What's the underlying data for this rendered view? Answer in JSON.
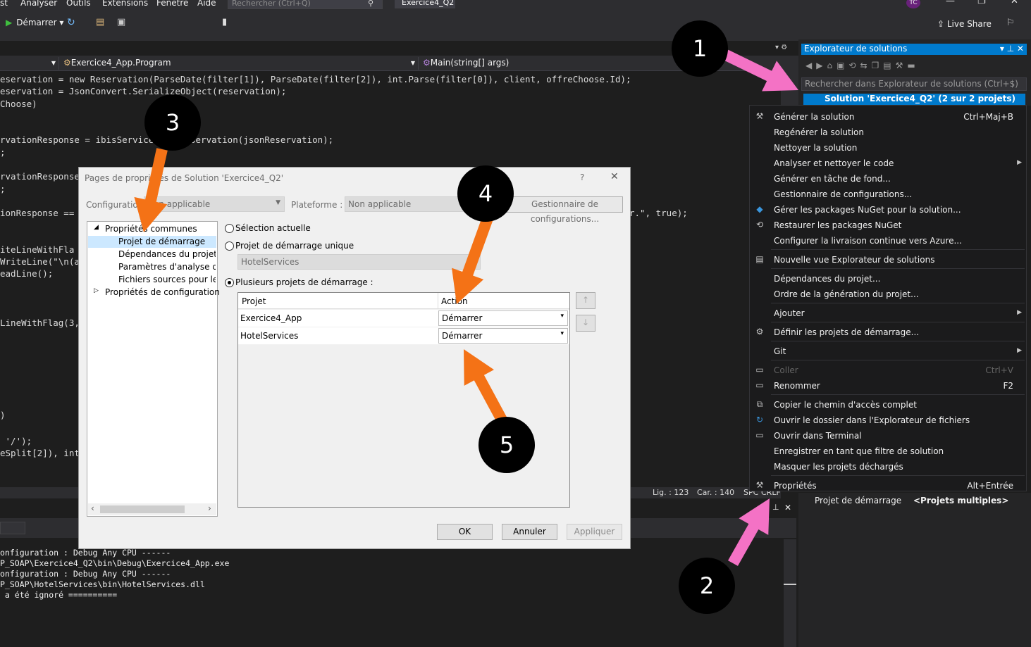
{
  "menubar": {
    "items": [
      "st",
      "Analyser",
      "Outils",
      "Extensions",
      "Fenêtre",
      "Aide"
    ],
    "search_placeholder": "Rechercher (Ctrl+Q)",
    "window_title": "Exercice4_Q2",
    "user_initials": "TC"
  },
  "toolbar": {
    "start_label": "Démarrer",
    "live_share": "Live Share"
  },
  "nav": {
    "class_combo": "Exercice4_App.Program",
    "method_combo": "Main(string[] args)"
  },
  "code_lines": [
    "eservation = new Reservation(ParseDate(filter[1]), ParseDate(filter[2]), int.Parse(filter[0]), client, offreChoose.Id);",
    "eservation = JsonConvert.SerializeObject(reservation);",
    "Choose)",
    "",
    "",
    "rvationResponse = ibisServices",
    ";",
    "",
    "rvationResponse",
    ";",
    "",
    "ionResponse ==",
    "",
    "",
    "iteLineWithFla",
    "WriteLine(\"\\n(ap",
    "eadLine();",
    "",
    "",
    "",
    "LineWithFlag(3,"
  ],
  "code_fragments": {
    "reservation_call": "servation(jsonReservation);",
    "tail_fragment": "r.\", true);",
    "paren": ")",
    "slash": " '/');",
    "split": "eSplit[2]), int"
  },
  "statusbar": {
    "line": "Lig. : 123",
    "col": "Car. : 140",
    "spc": "SPC",
    "crlf": "CRLF"
  },
  "output_lines": [
    "onfiguration : Debug Any CPU ------",
    "P_SOAP\\Exercice4_Q2\\bin\\Debug\\Exercice4_App.exe",
    "onfiguration : Debug Any CPU ------",
    "P_SOAP\\HotelServices\\bin\\HotelServices.dll",
    " a été ignoré =========="
  ],
  "solution_explorer": {
    "title": "Explorateur de solutions",
    "search_placeholder": "Rechercher dans Explorateur de solutions (Ctrl+$)",
    "solution_row": "Solution 'Exercice4_Q2' (2 sur 2 projets)"
  },
  "properties_pane": {
    "key": "Projet de démarrage",
    "value": "<Projets multiples>"
  },
  "context_menu": {
    "items": [
      {
        "label": "Générer la solution",
        "shortcut": "Ctrl+Maj+B",
        "icon": "build-icon",
        "disabled": false,
        "submenu": false
      },
      {
        "label": "Regénérer la solution",
        "shortcut": "",
        "icon": "",
        "disabled": false,
        "submenu": false
      },
      {
        "label": "Nettoyer la solution",
        "shortcut": "",
        "icon": "",
        "disabled": false,
        "submenu": false
      },
      {
        "label": "Analyser et nettoyer le code",
        "shortcut": "",
        "icon": "",
        "disabled": false,
        "submenu": true
      },
      {
        "label": "Générer en tâche de fond...",
        "shortcut": "",
        "icon": "",
        "disabled": false,
        "submenu": false
      },
      {
        "label": "Gestionnaire de configurations...",
        "shortcut": "",
        "icon": "",
        "disabled": false,
        "submenu": false
      },
      {
        "label": "Gérer les packages NuGet pour la solution...",
        "shortcut": "",
        "icon": "nuget-icon",
        "disabled": false,
        "submenu": false
      },
      {
        "label": "Restaurer les packages NuGet",
        "shortcut": "",
        "icon": "restore-icon",
        "disabled": false,
        "submenu": false
      },
      {
        "label": "Configurer la livraison continue vers Azure...",
        "shortcut": "",
        "icon": "",
        "disabled": false,
        "submenu": false
      },
      {
        "label": "Nouvelle vue Explorateur de solutions",
        "shortcut": "",
        "icon": "new-view-icon",
        "disabled": false,
        "submenu": false
      },
      {
        "label": "Dépendances du projet...",
        "shortcut": "",
        "icon": "",
        "disabled": false,
        "submenu": false
      },
      {
        "label": "Ordre de la génération du projet...",
        "shortcut": "",
        "icon": "",
        "disabled": false,
        "submenu": false
      },
      {
        "label": "Ajouter",
        "shortcut": "",
        "icon": "",
        "disabled": false,
        "submenu": true
      },
      {
        "label": "Définir les projets de démarrage...",
        "shortcut": "",
        "icon": "gear-icon",
        "disabled": false,
        "submenu": false
      },
      {
        "label": "Git",
        "shortcut": "",
        "icon": "",
        "disabled": false,
        "submenu": true
      },
      {
        "label": "Coller",
        "shortcut": "Ctrl+V",
        "icon": "paste-icon",
        "disabled": true,
        "submenu": false
      },
      {
        "label": "Renommer",
        "shortcut": "F2",
        "icon": "rename-icon",
        "disabled": false,
        "submenu": false
      },
      {
        "label": "Copier le chemin d'accès complet",
        "shortcut": "",
        "icon": "copy-icon",
        "disabled": false,
        "submenu": false
      },
      {
        "label": "Ouvrir le dossier dans l'Explorateur de fichiers",
        "shortcut": "",
        "icon": "refresh-icon",
        "disabled": false,
        "submenu": false
      },
      {
        "label": "Ouvrir dans Terminal",
        "shortcut": "",
        "icon": "terminal-icon",
        "disabled": false,
        "submenu": false
      },
      {
        "label": "Enregistrer en tant que filtre de solution",
        "shortcut": "",
        "icon": "",
        "disabled": false,
        "submenu": false
      },
      {
        "label": "Masquer les projets déchargés",
        "shortcut": "",
        "icon": "",
        "disabled": false,
        "submenu": false
      },
      {
        "label": "Propriétés",
        "shortcut": "Alt+Entrée",
        "icon": "wrench-icon",
        "disabled": false,
        "submenu": false
      }
    ]
  },
  "dialog": {
    "title": "Pages de propriétés de Solution 'Exercice4_Q2'",
    "help": "?",
    "config_label": "Configuration :",
    "config_value": "Non applicable",
    "platform_label": "Plateforme :",
    "platform_value": "Non applicable",
    "config_manager": "Gestionnaire de configurations...",
    "tree": {
      "common": "Propriétés communes",
      "startup": "Projet de démarrage",
      "deps": "Dépendances du projet",
      "analysis": "Paramètres d'analyse du code",
      "sources": "Fichiers sources pour le débogage",
      "config_props": "Propriétés de configuration"
    },
    "radio_current": "Sélection actuelle",
    "radio_single": "Projet de démarrage unique",
    "single_value": "HotelServices",
    "radio_multiple": "Plusieurs projets de démarrage :",
    "grid_headers": [
      "Projet",
      "Action"
    ],
    "grid_rows": [
      {
        "project": "Exercice4_App",
        "action": "Démarrer"
      },
      {
        "project": "HotelServices",
        "action": "Démarrer"
      }
    ],
    "ok": "OK",
    "cancel": "Annuler",
    "apply": "Appliquer"
  },
  "callouts": [
    "1",
    "2",
    "3",
    "4",
    "5"
  ],
  "colors": {
    "pink_arrow": "#f472c5",
    "orange_arrow": "#f47216",
    "accent": "#007acc"
  }
}
